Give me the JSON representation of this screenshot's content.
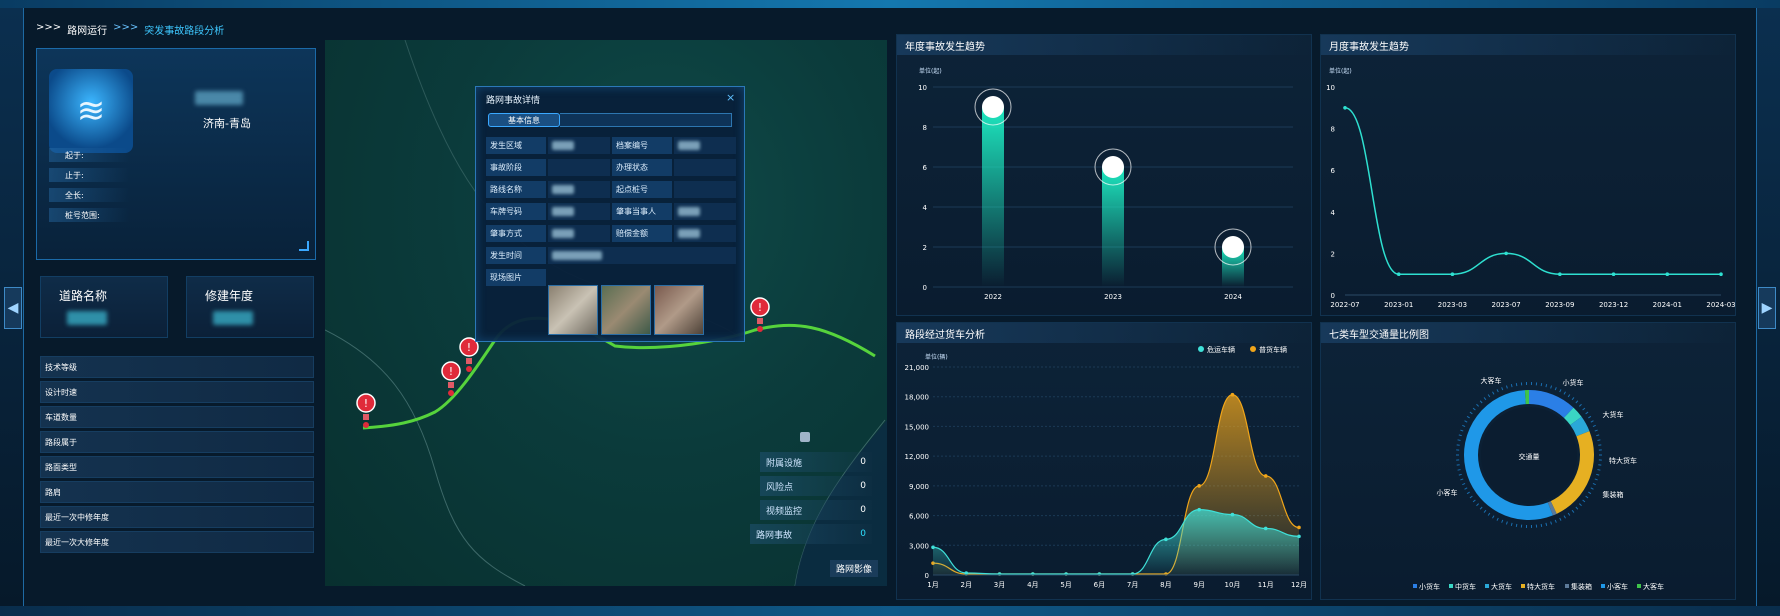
{
  "breadcrumb": {
    "prefix": ">>>",
    "item1": "路网运行",
    "sep": ">>>",
    "item2": "突发事故路段分析"
  },
  "info_card": {
    "route": "济南-青岛",
    "rows": [
      {
        "label": "起于:",
        "value": ""
      },
      {
        "label": "止于:",
        "value": ""
      },
      {
        "label": "全长:",
        "value": ""
      },
      {
        "label": "桩号范围:",
        "value": ""
      }
    ]
  },
  "road_name": {
    "title": "道路名称"
  },
  "build_year": {
    "title": "修建年度"
  },
  "props": [
    {
      "label": "技术等级",
      "value": ""
    },
    {
      "label": "设计时速",
      "value": ""
    },
    {
      "label": "车道数量",
      "value": ""
    },
    {
      "label": "路段属于",
      "value": ""
    },
    {
      "label": "路面类型",
      "value": ""
    },
    {
      "label": "路肩",
      "value": ""
    },
    {
      "label": "最近一次中修年度",
      "value": ""
    },
    {
      "label": "最近一次大修年度",
      "value": ""
    }
  ],
  "modal": {
    "title": "路网事故详情",
    "close": "×",
    "tab": "基本信息",
    "cells": [
      {
        "l": "发生区域",
        "r": "档案编号"
      },
      {
        "l": "事故阶段",
        "r": "办理状态"
      },
      {
        "l": "路线名称",
        "r": "起点桩号"
      },
      {
        "l": "车牌号码",
        "r": "肇事当事人"
      },
      {
        "l": "肇事方式",
        "r": "赔偿金额"
      },
      {
        "l": "发生时间",
        "r": ""
      },
      {
        "l": "现场图片",
        "r": ""
      }
    ]
  },
  "map_legend": [
    {
      "label": "附属设施",
      "value": "0"
    },
    {
      "label": "风险点",
      "value": "0"
    },
    {
      "label": "视频监控",
      "value": "0"
    },
    {
      "label": "路网事故",
      "value": "0"
    }
  ],
  "map_button": "路网影像",
  "colors": {
    "accent": "#2ee0ff",
    "green_route": "#56d33c",
    "teal": "#1de8c0",
    "orange": "#f0a51a"
  },
  "chart_data": [
    {
      "type": "bar",
      "title": "年度事故发生趋势",
      "unit": "单位(起)",
      "categories": [
        "2022",
        "2023",
        "2024"
      ],
      "values": [
        9,
        6,
        2
      ],
      "ylim": [
        0,
        10
      ],
      "yticks": [
        "0",
        "2",
        "4",
        "6",
        "8",
        "10"
      ]
    },
    {
      "type": "line",
      "title": "月度事故发生趋势",
      "unit": "单位(起)",
      "x": [
        "2022-07",
        "2023-01",
        "2023-03",
        "2023-07",
        "2023-09",
        "2023-12",
        "2024-01",
        "2024-03"
      ],
      "values": [
        9,
        1,
        1,
        2,
        1,
        1,
        1,
        1
      ],
      "ylim": [
        0,
        10
      ],
      "yticks": [
        "0",
        "2",
        "4",
        "6",
        "8",
        "10"
      ]
    },
    {
      "type": "area",
      "title": "路段经过货车分析",
      "unit": "单位(辆)",
      "categories": [
        "1月",
        "2月",
        "3月",
        "4月",
        "5月",
        "6月",
        "7月",
        "8月",
        "9月",
        "10月",
        "11月",
        "12月"
      ],
      "series": [
        {
          "name": "危运车辆",
          "values": [
            2800,
            200,
            100,
            100,
            100,
            100,
            100,
            3600,
            6600,
            6100,
            4700,
            3900
          ]
        },
        {
          "name": "普货车辆",
          "values": [
            1200,
            100,
            100,
            100,
            100,
            100,
            100,
            100,
            9000,
            18200,
            10000,
            4800
          ]
        }
      ],
      "ylim": [
        0,
        21000
      ],
      "yticks": [
        "0",
        "3,000",
        "6,000",
        "9,000",
        "12,000",
        "15,000",
        "18,000",
        "21,000"
      ]
    },
    {
      "type": "pie",
      "title": "七类车型交通量比例图",
      "center_label": "交通量",
      "categories": [
        "小货车",
        "中货车",
        "大货车",
        "特大货车",
        "集装箱",
        "小客车",
        "大客车"
      ],
      "slice_labels": [
        "小货车",
        "大货车",
        "特大货车",
        "集装箱",
        "小客车",
        "大客车"
      ],
      "values": [
        12,
        3,
        4,
        24,
        1,
        55,
        1
      ],
      "colors": [
        "#2b7fe6",
        "#3ad6c4",
        "#2aa8d8",
        "#e6b022",
        "#5c7a99",
        "#1f98e8",
        "#3fc44a"
      ]
    }
  ]
}
